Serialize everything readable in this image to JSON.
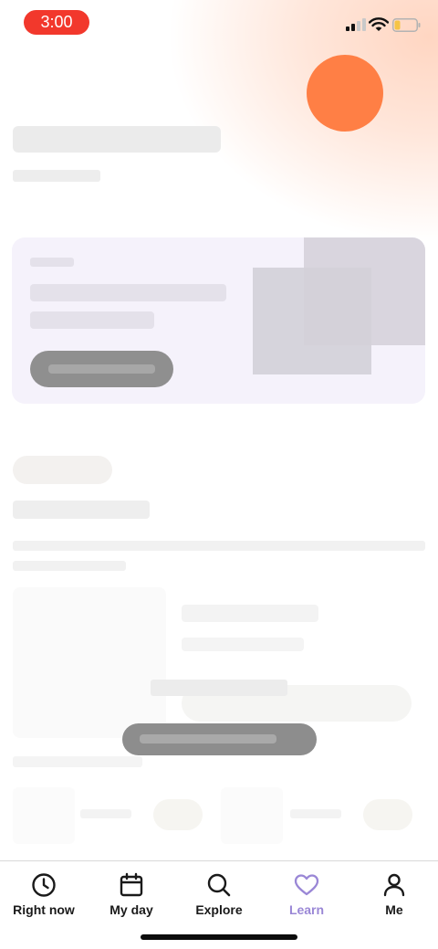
{
  "status_bar": {
    "time": "3:00",
    "icons": [
      "cellular-signal-icon",
      "wifi-icon",
      "battery-icon"
    ],
    "time_pill_color": "#f2382c"
  },
  "accent": {
    "blob_color": "#ff7f45",
    "active_tab_color": "#9a87d6"
  },
  "tabbar": {
    "active": "learn",
    "items": [
      {
        "id": "right-now",
        "label": "Right now",
        "icon": "clock-icon"
      },
      {
        "id": "my-day",
        "label": "My day",
        "icon": "calendar-icon"
      },
      {
        "id": "explore",
        "label": "Explore",
        "icon": "search-icon"
      },
      {
        "id": "learn",
        "label": "Learn",
        "icon": "heart-icon"
      },
      {
        "id": "me",
        "label": "Me",
        "icon": "person-icon"
      }
    ]
  }
}
